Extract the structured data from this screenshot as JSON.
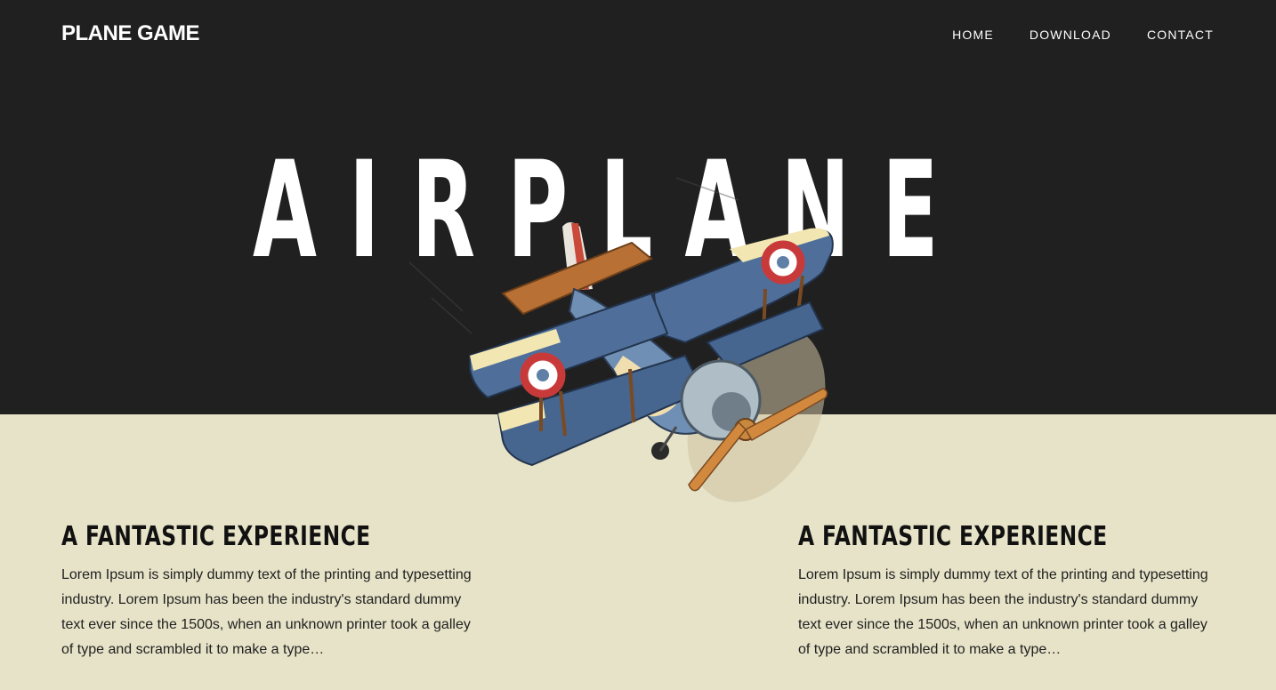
{
  "header": {
    "brand": "PLANE GAME",
    "nav": [
      "HOME",
      "DOWNLOAD",
      "CONTACT"
    ]
  },
  "hero": {
    "title": "AIRPLANE",
    "image_icon": "biplane-illustration"
  },
  "features": [
    {
      "title": "A FANTASTIC EXPERIENCE",
      "text": "Lorem Ipsum is simply dummy text of the printing and typesetting industry. Lorem Ipsum has been the industry's standard dummy text ever since the 1500s, when an unknown printer took a galley of type and scrambled it to make a type…"
    },
    {
      "title": "A FANTASTIC EXPERIENCE",
      "text": "Lorem Ipsum is simply dummy text of the printing and typesetting industry. Lorem Ipsum has been the industry's standard dummy text ever since the 1500s, when an unknown printer took a galley of type and scrambled it to make a type…"
    }
  ],
  "colors": {
    "hero_background": "#202020",
    "page_background": "#e7e3c8",
    "wing_blue": "#4f6f9a",
    "wood": "#b87034"
  }
}
